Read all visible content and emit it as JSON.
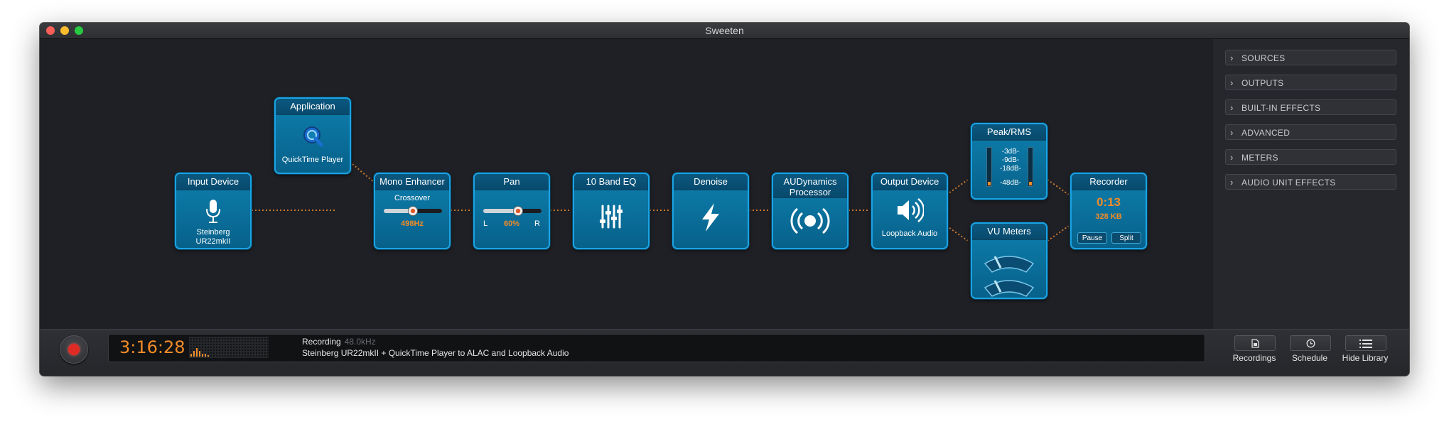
{
  "window": {
    "title": "Sweeten"
  },
  "modules": {
    "input_device": {
      "title": "Input Device",
      "device_line1": "Steinberg",
      "device_line2": "UR22mkII"
    },
    "application": {
      "title": "Application",
      "app": "QuickTime Player"
    },
    "mono_enhancer": {
      "title": "Mono Enhancer",
      "label": "Crossover",
      "value": "498Hz",
      "level": 0.5
    },
    "pan": {
      "title": "Pan",
      "left": "L",
      "value": "60%",
      "right": "R",
      "level": 0.6
    },
    "eq": {
      "title": "10 Band EQ"
    },
    "denoise": {
      "title": "Denoise"
    },
    "audynamics": {
      "title_line1": "AUDynamics",
      "title_line2": "Processor"
    },
    "output_device": {
      "title": "Output Device",
      "device": "Loopback Audio"
    },
    "peak_rms": {
      "title": "Peak/RMS",
      "scale": [
        "-3dB-",
        "-9dB-",
        "-18dB-",
        "-48dB-"
      ]
    },
    "vu_meters": {
      "title": "VU Meters"
    },
    "recorder": {
      "title": "Recorder",
      "time": "0:13",
      "size": "328 KB",
      "pause_label": "Pause",
      "split_label": "Split"
    }
  },
  "sidebar": {
    "items": [
      {
        "label": "SOURCES"
      },
      {
        "label": "OUTPUTS"
      },
      {
        "label": "BUILT-IN EFFECTS"
      },
      {
        "label": "ADVANCED"
      },
      {
        "label": "METERS"
      },
      {
        "label": "AUDIO UNIT EFFECTS"
      }
    ]
  },
  "status": {
    "elapsed": "3:16:28",
    "state": "Recording",
    "sample_rate": "48.0kHz",
    "description": "Steinberg UR22mkII  + QuickTime Player to ALAC and Loopback Audio"
  },
  "toolbar": {
    "recordings_label": "Recordings",
    "schedule_label": "Schedule",
    "hide_library_label": "Hide Library"
  },
  "colors": {
    "accent": "#f28c28",
    "module": "#0e7fae",
    "module_border": "#1aa3e3",
    "record": "#e02a24"
  },
  "icons": {
    "input_device": "microphone-icon",
    "application": "quicktime-icon",
    "eq": "eq-sliders-icon",
    "denoise": "lightning-icon",
    "audynamics": "broadcast-icon",
    "output_device": "speaker-icon",
    "vu_meters": "vu-gauge-icon",
    "recordings": "document-icon",
    "schedule": "clock-icon",
    "hide_library": "list-icon"
  }
}
